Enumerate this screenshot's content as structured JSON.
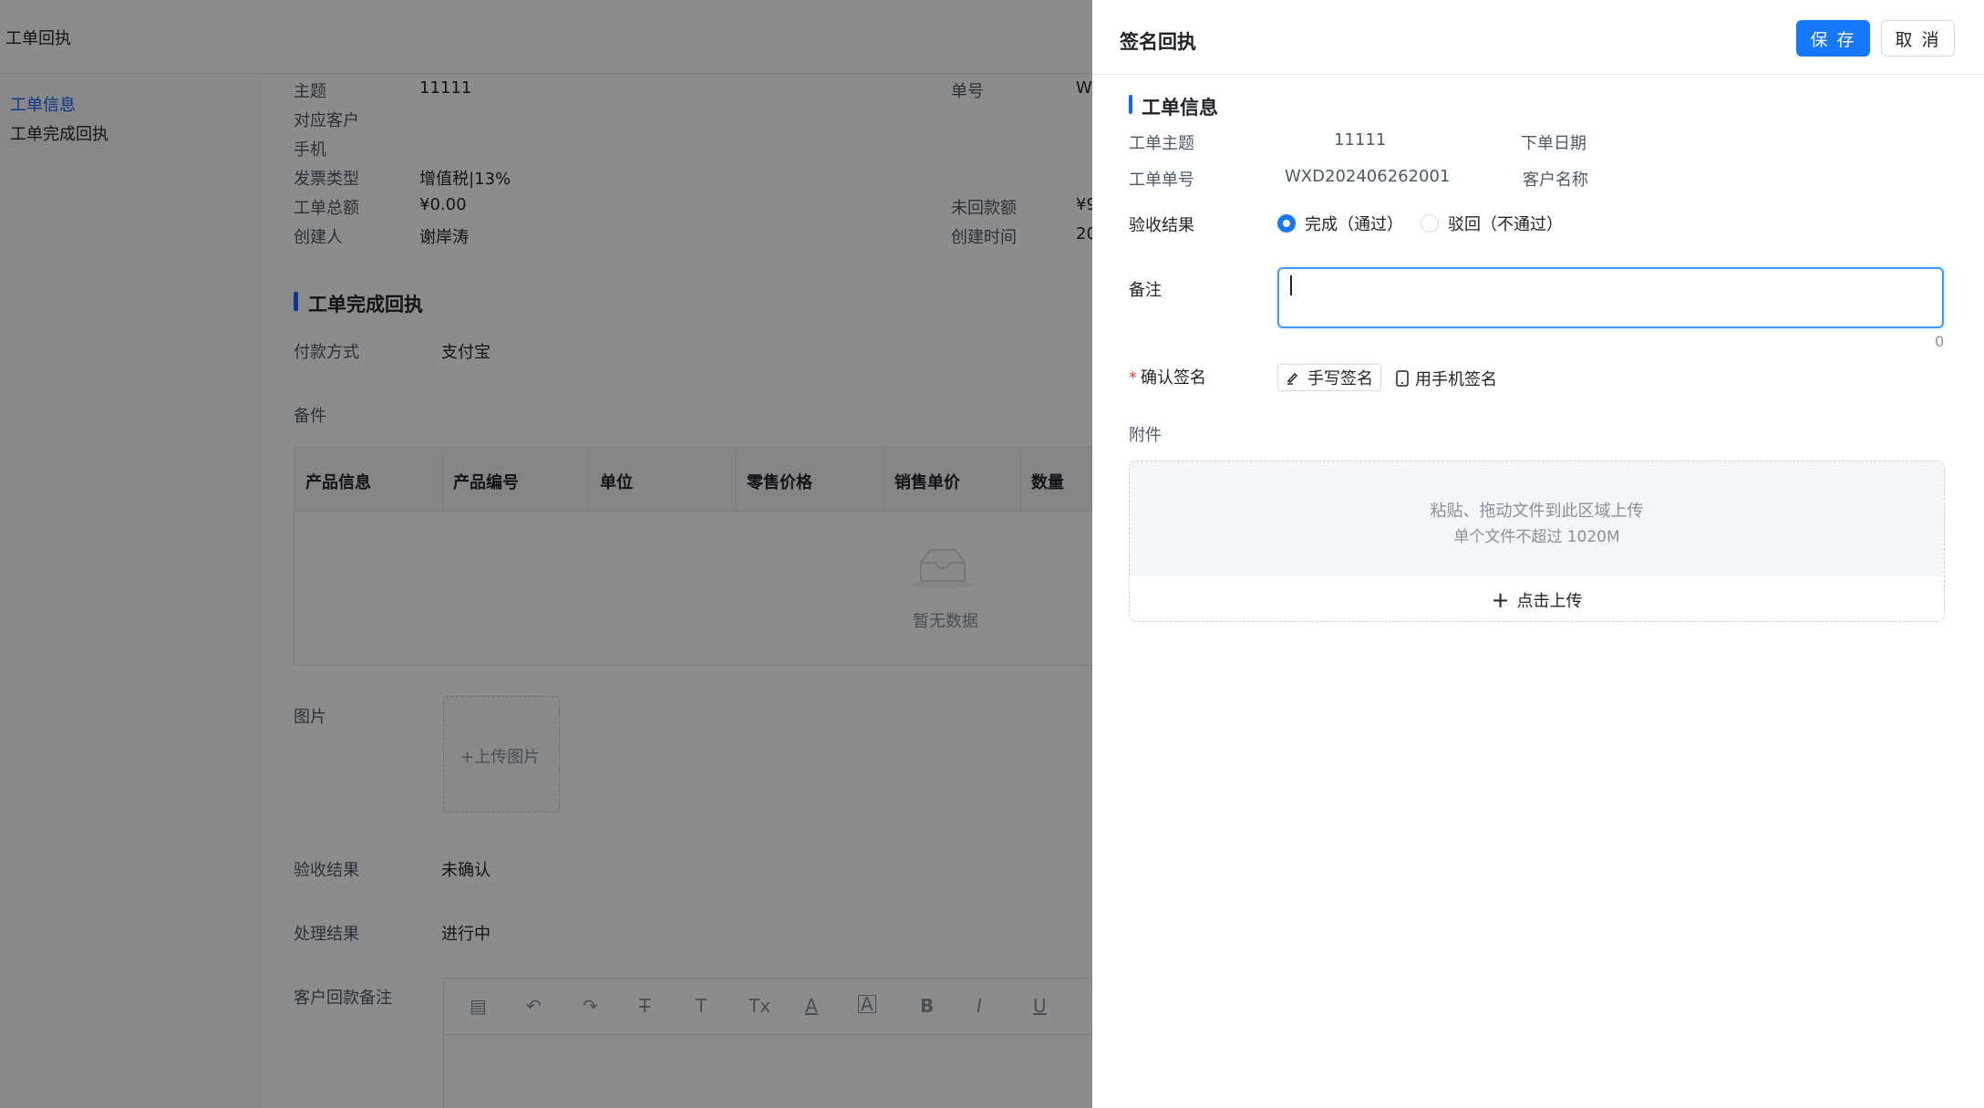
{
  "background": {
    "topbar_title": "工单回执",
    "sidebar": [
      "工单信息",
      "工单完成回执"
    ],
    "info": [
      {
        "label": "主题",
        "value": "11111"
      },
      {
        "label": "对应客户",
        "value": ""
      },
      {
        "label": "手机",
        "value": ""
      },
      {
        "label": "发票类型",
        "value": "增值税|13%"
      },
      {
        "label": "工单总额",
        "value": "¥0.00"
      },
      {
        "label": "创建人",
        "value": "谢岸涛"
      }
    ],
    "info_right": [
      {
        "label": "单号",
        "value": "W"
      },
      {
        "label": "未回款额",
        "value": "¥9"
      },
      {
        "label": "创建时间",
        "value": "20"
      }
    ],
    "section_title": "工单完成回执",
    "payment_label": "付款方式",
    "payment_value": "支付宝",
    "remark_label": "备件",
    "table_headers": [
      "产品信息",
      "产品编号",
      "单位",
      "零售价格",
      "销售单价",
      "数量"
    ],
    "empty_text": "暂无数据",
    "image_label": "图片",
    "upload_image": "+上传图片",
    "accept_label": "验收结果",
    "accept_value": "未确认",
    "process_label": "处理结果",
    "process_value": "进行中",
    "customer_remark_label": "客户回款备注"
  },
  "drawer": {
    "title": "签名回执",
    "save_label": "保 存",
    "cancel_label": "取 消",
    "section_title": "工单信息",
    "subject_label": "工单主题",
    "subject_value": "11111",
    "order_date_label": "下单日期",
    "order_no_label": "工单单号",
    "order_no_value": "WXD202406262001",
    "customer_label": "客户名称",
    "result_label": "验收结果",
    "result_options": [
      "完成（通过）",
      "驳回（不通过）"
    ],
    "result_selected": 0,
    "remark_label": "备注",
    "remark_value": "",
    "remark_count": "0",
    "sign_label": "确认签名",
    "sign_required_mark": "*",
    "handwrite_label": "手写签名",
    "phone_sign_label": "用手机签名",
    "attachment_label": "附件",
    "drop_hint_1": "粘贴、拖动文件到此区域上传",
    "drop_hint_2": "单个文件不超过 1020M",
    "upload_label": "点击上传"
  },
  "colors": {
    "primary": "#1677ff",
    "accent_bar": "#1664ff",
    "mask": "rgba(0,0,0,0.45)"
  }
}
